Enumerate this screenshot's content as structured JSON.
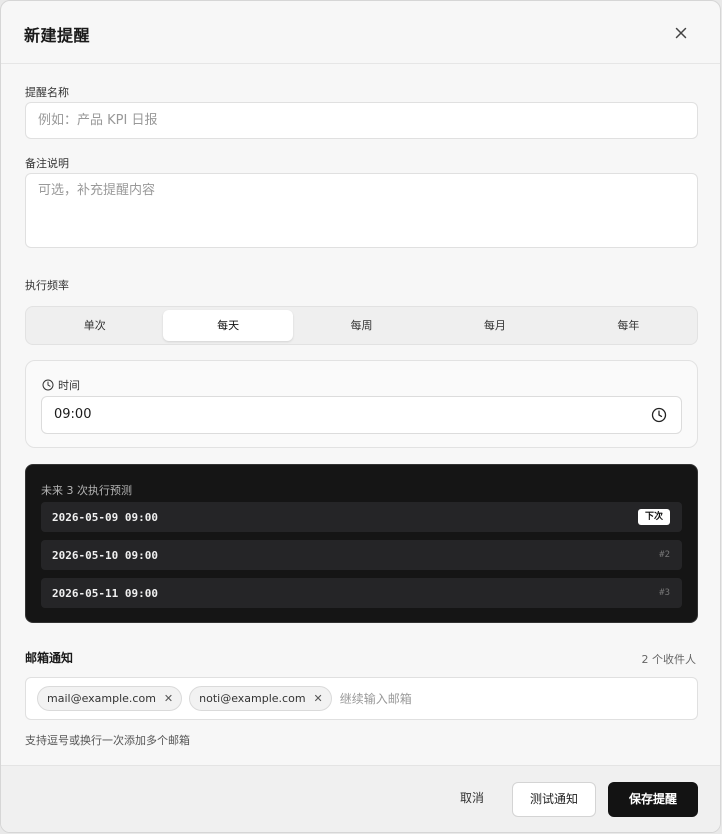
{
  "dialog": {
    "title": "新建提醒"
  },
  "name_field": {
    "label": "提醒名称",
    "placeholder": "例如：产品 KPI 日报"
  },
  "note_field": {
    "label": "备注说明",
    "placeholder": "可选，补充提醒内容"
  },
  "frequency": {
    "label": "执行频率",
    "options": [
      "单次",
      "每天",
      "每周",
      "每月",
      "每年"
    ],
    "selected": "每天"
  },
  "time": {
    "label": "时间",
    "value": "09:00"
  },
  "preview": {
    "title": "未来 3 次执行预测",
    "rows": [
      {
        "datetime": "2026-05-09 09:00",
        "tag": "下次"
      },
      {
        "datetime": "2026-05-10 09:00",
        "tag": "#2"
      },
      {
        "datetime": "2026-05-11 09:00",
        "tag": "#3"
      }
    ]
  },
  "email": {
    "title": "邮箱通知",
    "count": "2 个收件人",
    "recipients": [
      "mail@example.com",
      "noti@example.com"
    ],
    "input_placeholder": "继续输入邮箱",
    "hint": "支持逗号或换行一次添加多个邮箱"
  },
  "footer": {
    "cancel": "取消",
    "test": "测试通知",
    "save": "保存提醒"
  },
  "icons": {
    "close": "close-icon",
    "clock": "clock-icon",
    "chip_remove": "close-icon"
  },
  "colors": {
    "primary": "#131313",
    "preview_bg": "#151515",
    "row_bg": "#252527"
  }
}
